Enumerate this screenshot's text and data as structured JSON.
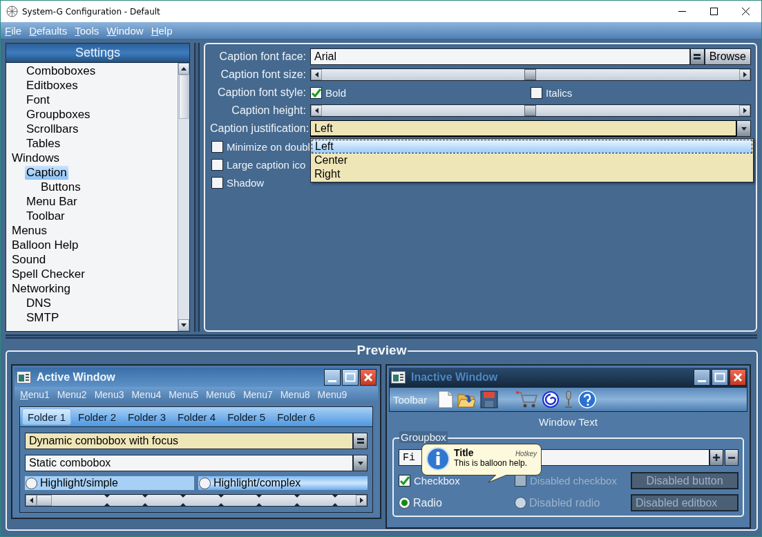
{
  "window": {
    "title": "System-G Configuration - Default"
  },
  "menu": [
    {
      "label": "File"
    },
    {
      "label": "Defaults"
    },
    {
      "label": "Tools"
    },
    {
      "label": "Window"
    },
    {
      "label": "Help"
    }
  ],
  "settings": {
    "title": "Settings",
    "items": [
      {
        "children": [
          {
            "label": "Comboboxes",
            "selected": false
          },
          {
            "label": "Editboxes",
            "selected": false
          },
          {
            "label": "Font",
            "selected": false
          },
          {
            "label": "Groupboxes",
            "selected": false
          },
          {
            "label": "Scrollbars",
            "selected": false
          },
          {
            "label": "Tables",
            "selected": false
          }
        ]
      },
      {
        "label": "Windows",
        "selected": false,
        "children": [
          {
            "label": "Caption",
            "selected": true,
            "children": [
              {
                "label": "Buttons",
                "selected": false
              }
            ]
          },
          {
            "label": "Menu Bar",
            "selected": false
          },
          {
            "label": "Toolbar",
            "selected": false
          }
        ]
      },
      {
        "label": "Menus",
        "selected": false
      },
      {
        "label": "Balloon Help",
        "selected": false
      },
      {
        "label": "Sound",
        "selected": false
      },
      {
        "label": "Spell Checker",
        "selected": false
      },
      {
        "label": "Networking",
        "selected": false,
        "children": [
          {
            "label": "DNS",
            "selected": false
          },
          {
            "label": "SMTP",
            "selected": false
          }
        ]
      }
    ]
  },
  "form": {
    "rows": [
      {
        "kind": "font",
        "label": "Caption font face:",
        "value": "Arial",
        "button": "Browse"
      },
      {
        "kind": "slider",
        "label": "Caption font size:",
        "level": 0.5
      },
      {
        "kind": "style",
        "label": "Caption font style:",
        "options": [
          {
            "label": "Bold",
            "checked": true
          },
          {
            "label": "Italics",
            "checked": false
          }
        ]
      },
      {
        "kind": "slider",
        "label": "Caption height:",
        "level": 0.5
      },
      {
        "kind": "dropdown",
        "label": "Caption justification:",
        "value": "Left",
        "expanded": true,
        "options": [
          {
            "label": "Left",
            "selected": true
          },
          {
            "label": "Center",
            "selected": false
          },
          {
            "label": "Right",
            "selected": false
          }
        ]
      },
      {
        "kind": "checkbox",
        "label": "Minimize on doubl",
        "checked": false
      },
      {
        "kind": "checkbox",
        "label": "Large caption ico",
        "checked": false
      },
      {
        "kind": "checkbox",
        "label": "Shadow",
        "checked": false
      }
    ]
  },
  "preview": {
    "title": "Preview",
    "active_window": {
      "title": "Active Window",
      "menus": [
        "Menu1",
        "Menu2",
        "Menu3",
        "Menu4",
        "Menu5",
        "Menu6",
        "Menu7",
        "Menu8",
        "Menu9"
      ],
      "tabs": [
        {
          "label": "Folder 1",
          "selected": true
        },
        {
          "label": "Folder 2",
          "selected": false
        },
        {
          "label": "Folder 3",
          "selected": false
        },
        {
          "label": "Folder 4",
          "selected": false
        },
        {
          "label": "Folder 5",
          "selected": false
        },
        {
          "label": "Folder 6",
          "selected": false
        }
      ],
      "dynamic_combobox": "Dynamic combobox with focus",
      "static_combobox": "Static combobox",
      "radios": [
        {
          "label": "Highlight/simple",
          "kind": "simple",
          "selected": false
        },
        {
          "label": "Highlight/complex",
          "kind": "complex",
          "selected": false
        }
      ]
    },
    "inactive_window": {
      "title": "Inactive Window",
      "toolbar_label": "Toolbar",
      "window_text": "Window Text",
      "groupbox": {
        "title": "Groupbox",
        "field": "Fi",
        "checkbox": {
          "label": "Checkbox",
          "checked": true
        },
        "disabled_checkbox": {
          "label": "Disabled checkbox",
          "checked": false
        },
        "disabled_button": "Disabled button",
        "radio": {
          "label": "Radio",
          "selected": true
        },
        "disabled_radio": {
          "label": "Disabled radio",
          "selected": false
        },
        "disabled_editbox": "Disabled editbox"
      },
      "balloon": {
        "title": "Title",
        "hotkey": "Hotkey",
        "text": "This is balloon help."
      }
    }
  }
}
